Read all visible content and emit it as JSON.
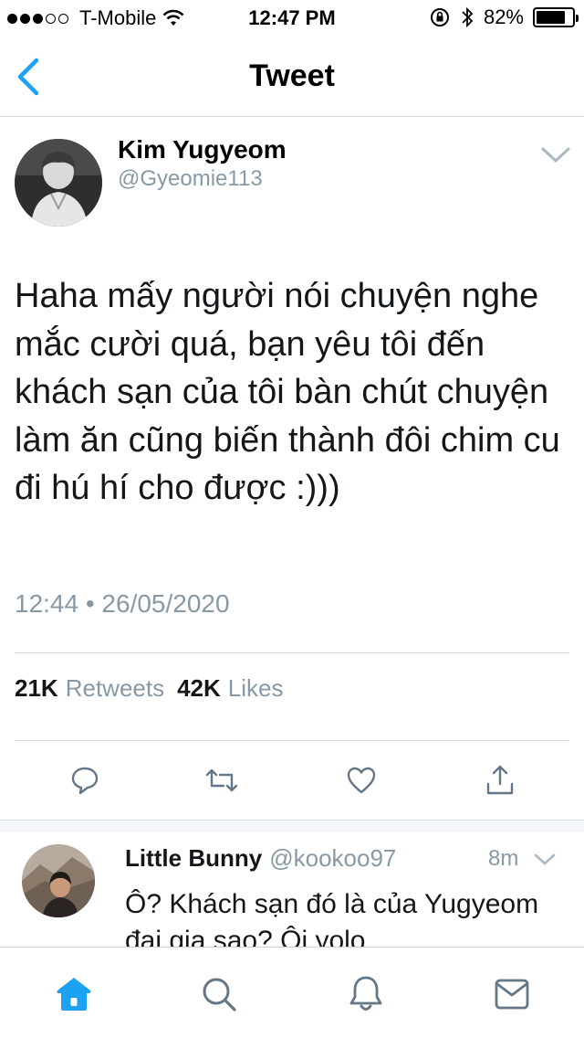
{
  "status_bar": {
    "carrier": "T-Mobile",
    "time": "12:47 PM",
    "battery": "82%",
    "battery_level": 0.82
  },
  "nav": {
    "title": "Tweet",
    "back_icon": "chevron-left-icon"
  },
  "tweet": {
    "author_name": "Kim Yugyeom",
    "author_handle": "@Gyeomie113",
    "text": "Haha mấy người nói chuyện nghe mắc cười quá, bạn yêu tôi đến khách sạn của tôi bàn chút chuyện làm ăn cũng biến thành đôi chim cu đi hú hí cho được :)))",
    "timestamp": "12:44 • 26/05/2020",
    "retweets_count": "21K",
    "retweets_label": "Retweets",
    "likes_count": "42K",
    "likes_label": "Likes"
  },
  "reply": {
    "name": "Little Bunny",
    "handle": "@kookoo97",
    "time": "8m",
    "text": "Ô? Khách sạn đó là của Yugyeom đại gia sao? Ôi yolo"
  },
  "colors": {
    "accent": "#1da1f2",
    "muted": "#8899a6",
    "text": "#14171a"
  },
  "tab_bar": {
    "items": [
      "home-icon",
      "search-icon",
      "notifications-icon",
      "messages-icon"
    ]
  }
}
